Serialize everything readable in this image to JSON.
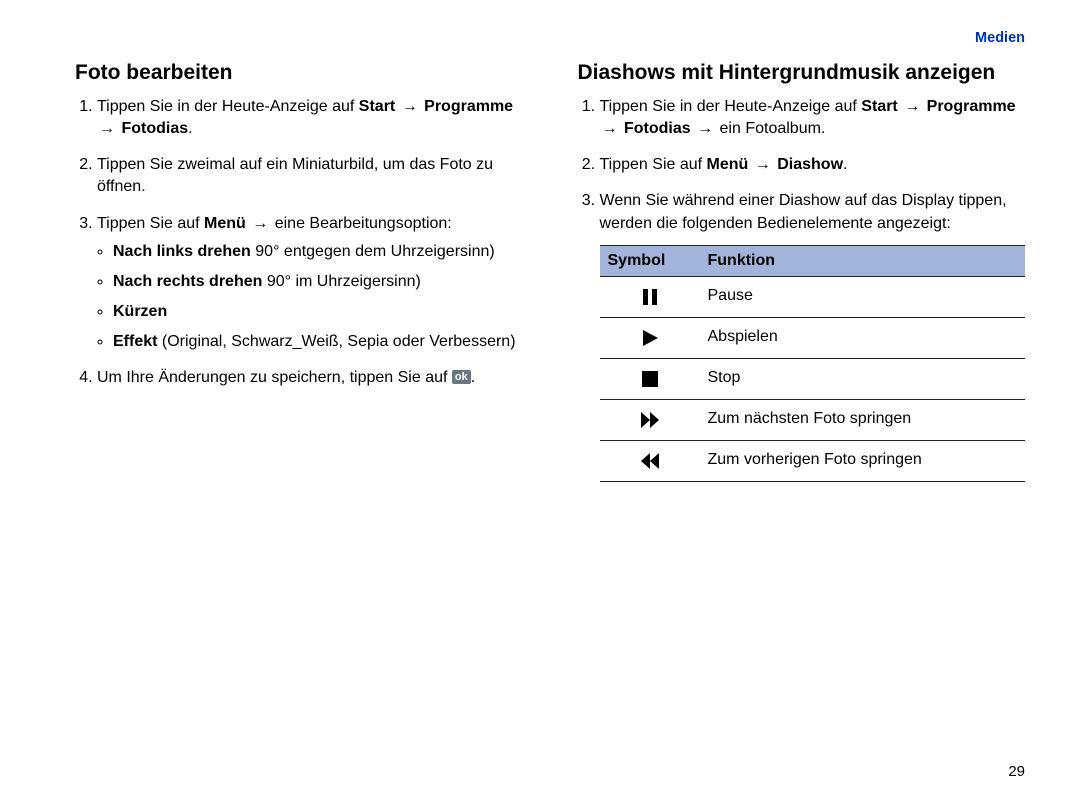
{
  "header": {
    "section": "Medien"
  },
  "page_number": "29",
  "left": {
    "title": "Foto bearbeiten",
    "step1_a": "Tippen Sie in der Heute-Anzeige auf ",
    "step1_b": "Start",
    "step1_c": "Programme",
    "step1_d": "Fotodias",
    "step2": "Tippen Sie zweimal auf ein Miniaturbild, um das Foto zu öffnen.",
    "step3_a": "Tippen Sie auf ",
    "step3_b": "Menü",
    "step3_c": "eine Bearbeitungsoption:",
    "bullets": {
      "b1_label": "Nach links drehen",
      "b1_text": " 90° entgegen dem Uhrzeigersinn)",
      "b2_label": "Nach rechts drehen",
      "b2_text": " 90° im Uhrzeigersinn)",
      "b3_label": "Kürzen",
      "b4_label": "Effekt",
      "b4_text": " (Original, Schwarz_Weiß, Sepia oder Verbessern)"
    },
    "step4_a": "Um Ihre Änderungen zu speichern, tippen Sie auf ",
    "step4_icon": "ok",
    "step4_b": "."
  },
  "right": {
    "title": "Diashows mit Hintergrundmusik anzeigen",
    "step1_a": "Tippen Sie in der Heute-Anzeige auf ",
    "step1_b": "Start",
    "step1_c": "Programme",
    "step1_d": "Fotodias",
    "step1_e": "ein Fotoalbum.",
    "step2_a": "Tippen Sie auf ",
    "step2_b": "Menü",
    "step2_c": "Diashow",
    "step3": "Wenn Sie während einer Diashow auf das Display tippen, werden die folgenden Bedienelemente angezeigt:",
    "table": {
      "head_symbol": "Symbol",
      "head_function": "Funktion",
      "rows": [
        {
          "icon": "pause",
          "func": "Pause"
        },
        {
          "icon": "play",
          "func": "Abspielen"
        },
        {
          "icon": "stop",
          "func": "Stop"
        },
        {
          "icon": "next",
          "func": "Zum nächsten Foto springen"
        },
        {
          "icon": "prev",
          "func": "Zum vorherigen Foto springen"
        }
      ]
    }
  },
  "arrow": "→"
}
